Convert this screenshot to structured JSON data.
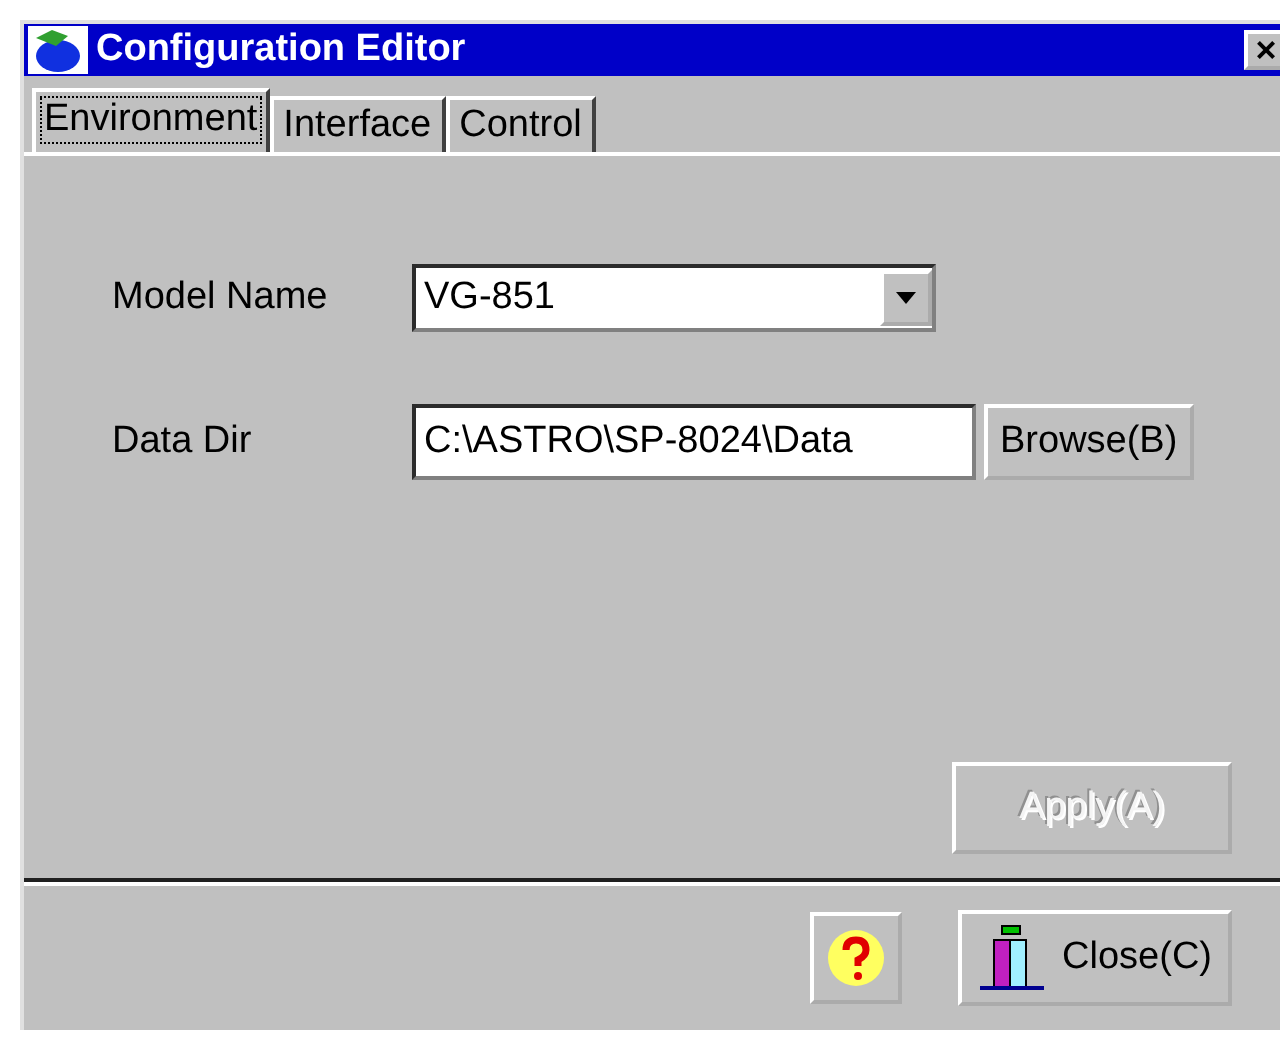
{
  "window": {
    "title": "Configuration Editor",
    "close_label": "×"
  },
  "tabs": [
    {
      "label": "Environment",
      "selected": true
    },
    {
      "label": "Interface",
      "selected": false
    },
    {
      "label": "Control",
      "selected": false
    }
  ],
  "fields": [
    {
      "kind": "dropdown",
      "label": "Model Name",
      "value": "VG-851"
    },
    {
      "kind": "browse",
      "label": "Data Dir",
      "value": "C:\\ASTRO\\SP-8024\\Data",
      "button": "Browse(B)"
    }
  ],
  "apply": {
    "label": "Apply(A)",
    "disabled": true
  },
  "close": {
    "label": "Close(C)"
  }
}
